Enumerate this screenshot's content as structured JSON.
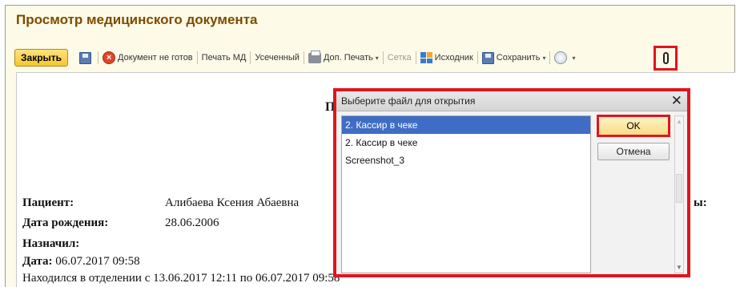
{
  "window": {
    "title": "Просмотр медицинского документа"
  },
  "toolbar": {
    "close_label": "Закрыть",
    "save_icon": "floppy-disk-icon",
    "not_ready_label": "Документ не готов",
    "print_md_label": "Печать МД",
    "truncated_label": "Усеченный",
    "extra_print_label": "Доп. Печать",
    "grid_label": "Сетка",
    "source_label": "Исходник",
    "save_label": "Сохранить",
    "attachment_icon": "paperclip-icon",
    "caret": "▾"
  },
  "document": {
    "heading_fragment": "П",
    "patient_label": "Пациент:",
    "patient_value": "Алибаева Ксения Абаевна",
    "birth_label": "Дата рождения:",
    "birth_value": "28.06.2006",
    "right_fragment": "ы:",
    "assigned_label": "Назначил:",
    "date_label": "Дата:",
    "date_value": "06.07.2017 09:58",
    "stay_text": "Находился в отделении с 13.06.2017 12:11 по 06.07.2017 09:58"
  },
  "dialog": {
    "title": "Выберите файл для открытия",
    "close_glyph": "✕",
    "files": [
      "2. Кассир в чеке",
      "2. Кассир в чеке",
      "Screenshot_3"
    ],
    "selected_index": 0,
    "ok_label": "OK",
    "cancel_label": "Отмена"
  },
  "colors": {
    "title": "#7d4b00",
    "highlight_frame": "#e0141e",
    "selection": "#3f6dc6",
    "panel_bg": "#fdfbe8"
  }
}
